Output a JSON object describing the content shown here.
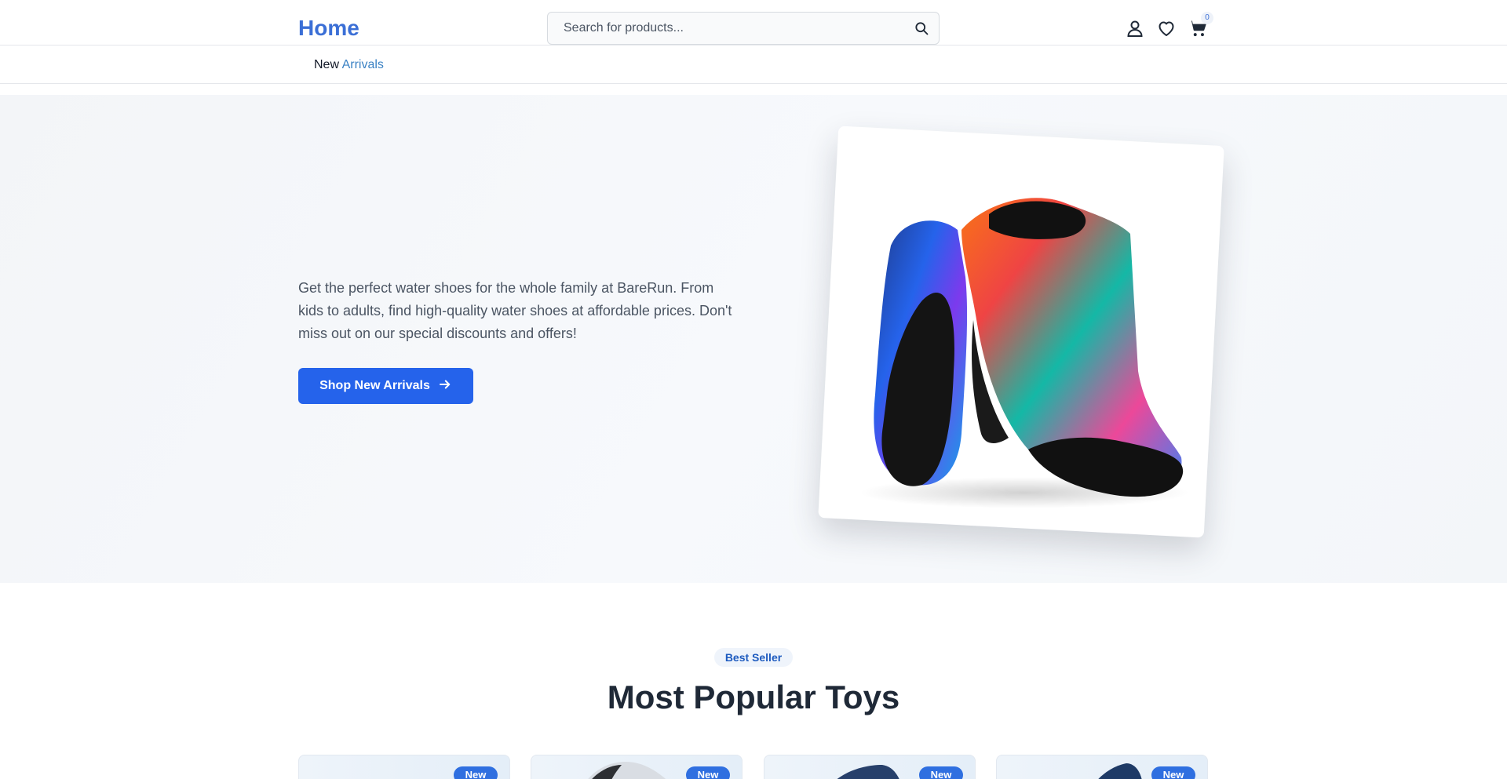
{
  "header": {
    "logo": "Home",
    "search_placeholder": "Search for products...",
    "cart_count": "0",
    "icons": [
      "search-icon",
      "user-icon",
      "heart-icon",
      "cart-icon"
    ]
  },
  "nav": {
    "link_word_1": "New",
    "link_word_2": "Arrivals"
  },
  "hero": {
    "description": "Get the perfect water shoes for the whole family at BareRun. From kids to adults, find high-quality water shoes at affordable prices. Don't miss out on our special discounts and offers!",
    "cta_label": "Shop New Arrivals",
    "cta_icon": "arrow-right-icon"
  },
  "best_seller": {
    "badge": "Best Seller",
    "title": "Most Popular Toys",
    "products": [
      {
        "tag": "New"
      },
      {
        "tag": "New"
      },
      {
        "tag": "New"
      },
      {
        "tag": "New"
      }
    ]
  },
  "colors": {
    "brand": "#3b6fd6",
    "cta": "#2563eb",
    "nav_accent": "#3b82c4"
  }
}
